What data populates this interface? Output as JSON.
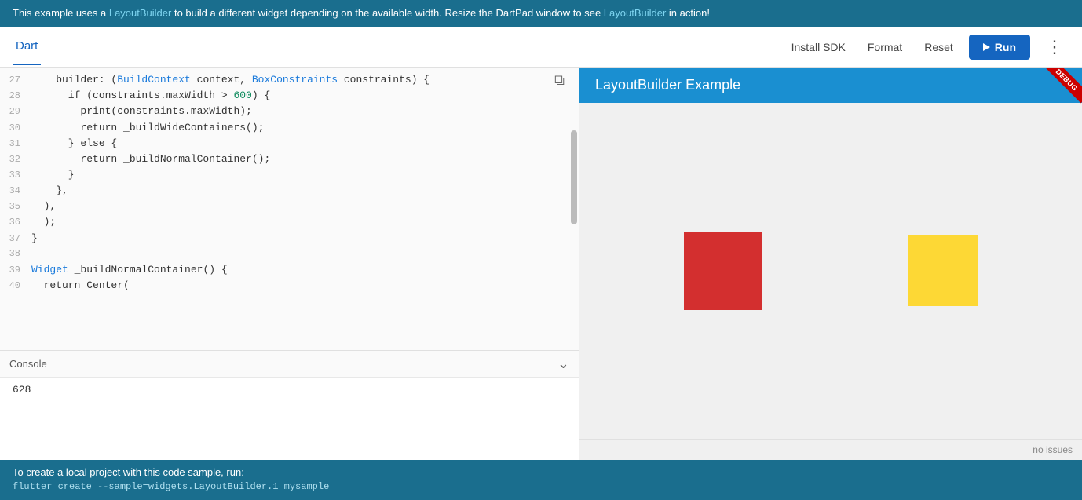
{
  "banner": {
    "text_before": "This example uses a ",
    "link1": "LayoutBuilder",
    "text_middle": " to build a different widget depending on the available width. Resize the DartPad window to see ",
    "link2": "LayoutBuilder",
    "text_after": " in action!"
  },
  "header": {
    "tab_label": "Dart",
    "install_sdk_label": "Install SDK",
    "format_label": "Format",
    "reset_label": "Reset",
    "run_label": "Run"
  },
  "code": {
    "lines": [
      {
        "num": "27",
        "content": "    builder: (BuildContext context, BoxConstraints constraints) {"
      },
      {
        "num": "28",
        "content": "      if (constraints.maxWidth > 600) {"
      },
      {
        "num": "29",
        "content": "        print(constraints.maxWidth);"
      },
      {
        "num": "30",
        "content": "        return _buildWideContainers();"
      },
      {
        "num": "31",
        "content": "      } else {"
      },
      {
        "num": "32",
        "content": "        return _buildNormalContainer();"
      },
      {
        "num": "33",
        "content": "      }"
      },
      {
        "num": "34",
        "content": "    },"
      },
      {
        "num": "35",
        "content": "  ),"
      },
      {
        "num": "36",
        "content": "  );"
      },
      {
        "num": "37",
        "content": "}"
      },
      {
        "num": "38",
        "content": ""
      },
      {
        "num": "39",
        "content": "Widget _buildNormalContainer() {"
      },
      {
        "num": "40",
        "content": "  return Center("
      }
    ]
  },
  "console": {
    "title": "Console",
    "output": "628"
  },
  "preview": {
    "title": "LayoutBuilder Example",
    "debug_label": "DEBUG",
    "no_issues": "no issues"
  },
  "footer": {
    "text": "To create a local project with this code sample, run:",
    "command": "flutter create --sample=widgets.LayoutBuilder.1 mysample"
  }
}
